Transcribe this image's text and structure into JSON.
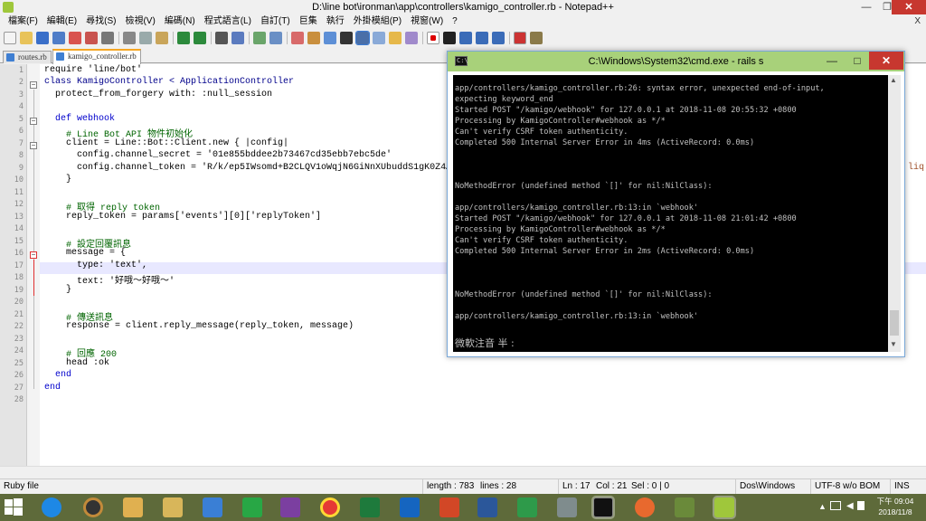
{
  "npp": {
    "title": "D:\\line bot\\ironman\\app\\controllers\\kamigo_controller.rb - Notepad++",
    "controls": {
      "minimize": "—",
      "maximize": "❐",
      "close": "✕"
    },
    "menu": [
      "檔案(F)",
      "編輯(E)",
      "尋找(S)",
      "檢視(V)",
      "編碼(N)",
      "程式語言(L)",
      "自訂(T)",
      "巨集",
      "執行",
      "外掛模組(P)",
      "視窗(W)",
      "?"
    ],
    "menu_right": "X",
    "tabs": [
      "routes.rb",
      "kamigo_controller.rb"
    ],
    "code_lines": [
      "require 'line/bot'",
      "class KamigoController < ApplicationController",
      "  protect_from_forgery with: :null_session",
      "",
      "  def webhook",
      "    # Line Bot API 物件初始化",
      "    client = Line::Bot::Client.new { |config|",
      "      config.channel_secret = '01e855bddee2b73467cd35ebb7ebc5de'",
      "      config.channel_token = 'R/k/ep5IWsomd+B2CLQV1oWqjN6GiNnXUbuddS1gK0Z4AE",
      "    }",
      "",
      "    # 取得 reply token",
      "    reply_token = params['events'][0]['replyToken']",
      "",
      "    # 設定回覆訊息",
      "    message = {",
      "      type: 'text',",
      "      text: '好哦～好哦～'",
      "    }",
      "",
      "    # 傳送訊息",
      "    response = client.reply_message(reply_token, message)",
      "",
      "    # 回應 200",
      "    head :ok",
      "  end",
      "end",
      ""
    ],
    "overflow_text": "liq",
    "status": {
      "lang": "Ruby file",
      "length": "length : 783",
      "lines": "lines : 28",
      "ln": "Ln : 17",
      "col": "Col : 21",
      "sel": "Sel : 0 | 0",
      "eol": "Dos\\Windows",
      "enc": "UTF-8 w/o BOM",
      "ins": "INS"
    }
  },
  "cmd": {
    "title": "C:\\Windows\\System32\\cmd.exe - rails  s",
    "controls": {
      "minimize": "—",
      "maximize": "□",
      "close": "✕"
    },
    "lines": [
      "app/controllers/kamigo_controller.rb:26: syntax error, unexpected end-of-input,",
      "expecting keyword_end",
      "Started POST \"/kamigo/webhook\" for 127.0.0.1 at 2018-11-08 20:55:32 +0800",
      "Processing by KamigoController#webhook as */*",
      "Can't verify CSRF token authenticity.",
      "Completed 500 Internal Server Error in 4ms (ActiveRecord: 0.0ms)",
      "",
      "",
      "",
      "NoMethodError (undefined method `[]' for nil:NilClass):",
      "",
      "app/controllers/kamigo_controller.rb:13:in `webhook'",
      "Started POST \"/kamigo/webhook\" for 127.0.0.1 at 2018-11-08 21:01:42 +0800",
      "Processing by KamigoController#webhook as */*",
      "Can't verify CSRF token authenticity.",
      "Completed 500 Internal Server Error in 2ms (ActiveRecord: 0.0ms)",
      "",
      "",
      "",
      "NoMethodError (undefined method `[]' for nil:NilClass):",
      "",
      "app/controllers/kamigo_controller.rb:13:in `webhook'"
    ],
    "ime": "微軟注音 半 :"
  },
  "taskbar": {
    "clock_time": "下午 09:04",
    "clock_date": "2018/11/8"
  }
}
